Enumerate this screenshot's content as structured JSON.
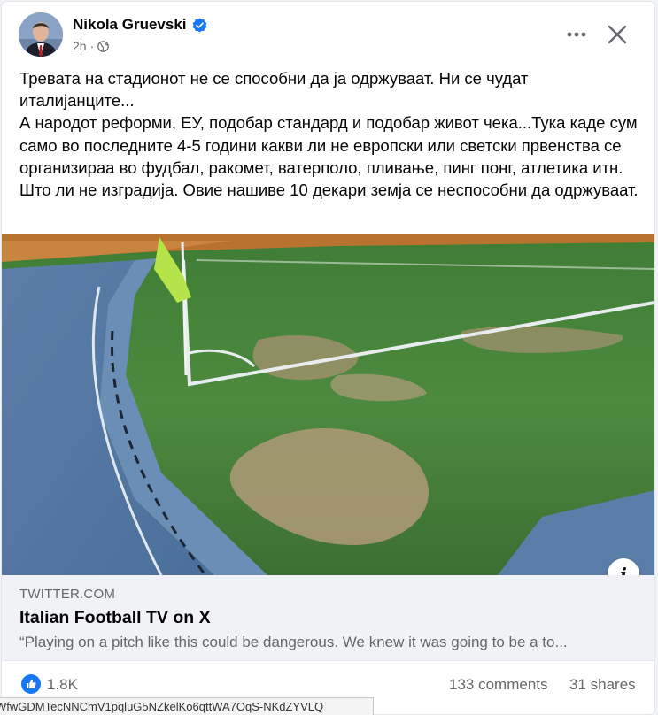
{
  "post": {
    "author": "Nikola Gruevski",
    "time": "2h",
    "separator": "·",
    "text": [
      "Тревата на стадионот не се способни да ја одржуваат. Ни се чудат италијанците...",
      "А народот реформи, ЕУ, подобар стандард и подобар живот чека...Тука каде сум само во последните 4-5 години какви ли не европски или светски првенства се организираа во фудбал, ракомет, ватерполо, пливање, пинг понг, атлетика итн. Што ли не изградија. Овие нашиве 10 декари земја се неспособни да одржуваат."
    ]
  },
  "icons": {
    "avatar": "profile-photo",
    "verified": "verified-badge-icon",
    "audience": "globe-icon",
    "more": "more-options-icon",
    "close": "close-icon",
    "info": "info-icon",
    "like": "like-icon"
  },
  "link_preview": {
    "domain": "TWITTER.COM",
    "title": "Italian Football TV on X",
    "description": "“Playing on a pitch like this could be dangerous. We knew it was going to be a to..."
  },
  "stats": {
    "likes": "1.8K",
    "comments": "133 comments",
    "shares": "31 shares"
  },
  "status_url": "WfwGDMTecNNCmV1pqluG5NZkelKo6qttWA7OqS-NKdZYVLQ",
  "colors": {
    "accent": "#1877f2",
    "secondary_text": "#65676b",
    "preview_bg": "#f0f2f5"
  }
}
